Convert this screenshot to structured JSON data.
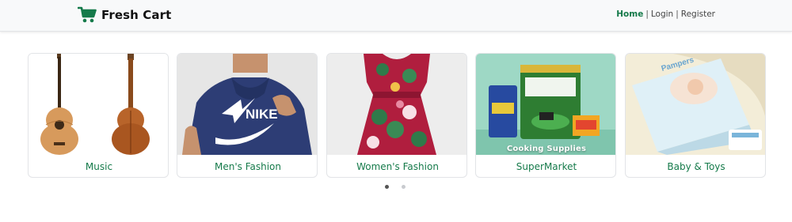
{
  "brand": {
    "name": "Fresh Cart",
    "icon": "cart-icon",
    "color": "#157a4a"
  },
  "nav": {
    "items": [
      {
        "label": "Home",
        "active": true
      },
      {
        "label": "Login",
        "active": false
      },
      {
        "label": "Register",
        "active": false
      }
    ],
    "separator": "|"
  },
  "categories": [
    {
      "label": "Music",
      "image": "guitar-image"
    },
    {
      "label": "Men's Fashion",
      "image": "hoodie-image"
    },
    {
      "label": "Women's Fashion",
      "image": "dress-image"
    },
    {
      "label": "SuperMarket",
      "image": "grocery-image",
      "overlay": "Cooking Supplies"
    },
    {
      "label": "Baby & Toys",
      "image": "diapers-image"
    }
  ],
  "pagination": {
    "pages": 2,
    "current": 1
  },
  "colors": {
    "accent": "#157a4a",
    "navbar_bg": "#f8f9fa"
  }
}
